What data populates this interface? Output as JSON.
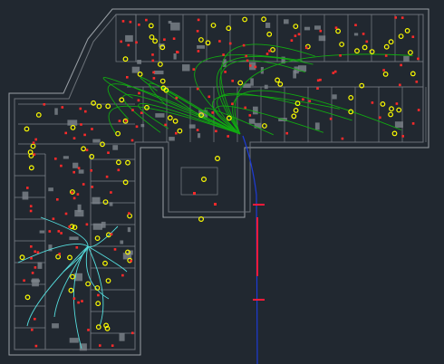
{
  "drawing": {
    "background": "#212830",
    "colors": {
      "wall": "#9aa0a6",
      "wall_dim": "#6b7178",
      "fixture": "#ffff00",
      "device": "#ff2a2a",
      "circuit_blue": "#2233ee",
      "circuit_green": "#11aa11",
      "circuit_cyan": "#55dddd",
      "feeder": "#1d3bd6",
      "feeder_mark": "#ff1a3a"
    },
    "layers": [
      "walls",
      "lighting-fixtures",
      "devices",
      "branch-circuits",
      "emergency-circuits",
      "feeder"
    ]
  }
}
